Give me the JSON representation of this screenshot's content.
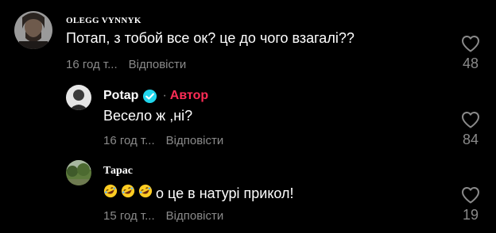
{
  "comments": [
    {
      "author": "OLEGG VYNNYK",
      "text": "Потап, з тобой все ок? це до чого взагалі??",
      "time": "16 год т...",
      "reply_label": "Відповісти",
      "likes": "48"
    },
    {
      "author": "Potap",
      "verified": true,
      "author_badge": "Автор",
      "text": "Весело ж ,ні?",
      "time": "16 год т...",
      "reply_label": "Відповісти",
      "likes": "84"
    },
    {
      "author": "Тарас",
      "emojis": [
        "rolling-on-floor-laughing-emoji",
        "rolling-on-floor-laughing-emoji",
        "rolling-on-floor-laughing-emoji"
      ],
      "text": "о це в натурі прикол!",
      "time": "15 год т...",
      "reply_label": "Відповісти",
      "likes": "19"
    }
  ],
  "colors": {
    "background": "#000000",
    "primary_text": "#ffffff",
    "secondary_text": "#8a8a8a",
    "author_badge": "#fe2c55",
    "verified_badge": "#20d5ec"
  }
}
